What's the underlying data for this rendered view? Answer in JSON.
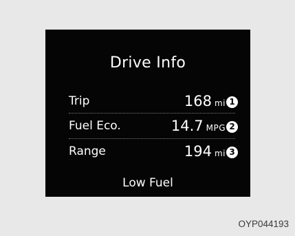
{
  "display": {
    "title": "Drive Info",
    "rows": [
      {
        "label": "Trip",
        "value": "168",
        "unit": "mi",
        "marker": "1"
      },
      {
        "label": "Fuel Eco.",
        "value": "14.7",
        "unit": "MPG",
        "marker": "2"
      },
      {
        "label": "Range",
        "value": "194",
        "unit": "mi",
        "marker": "3"
      }
    ],
    "warning": "Low Fuel"
  },
  "figure_code": "OYP044193"
}
